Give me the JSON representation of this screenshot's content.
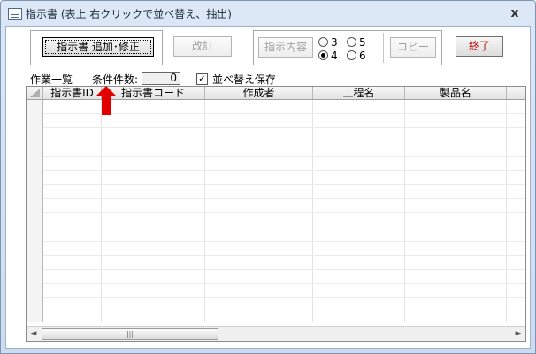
{
  "window": {
    "title": "指示書 (表上 右クリックで並べ替え、抽出)",
    "close_symbol": "x"
  },
  "toolbar": {
    "add_edit_label": "指示書 追加･修正",
    "revise_label": "改訂",
    "instructions_label": "指示内容",
    "copy_label": "コピー",
    "exit_label": "終了"
  },
  "radio_options": [
    {
      "label": "3",
      "checked": false
    },
    {
      "label": "5",
      "checked": false
    },
    {
      "label": "4",
      "checked": true
    },
    {
      "label": "6",
      "checked": false
    }
  ],
  "status": {
    "list_title": "作業一覧",
    "count_label": "条件件数:",
    "count_value": "0",
    "save_sort_label": "並べ替え保存",
    "save_sort_checked": true
  },
  "table": {
    "columns": [
      "指示書ID",
      "指示書コード",
      "作成者",
      "工程名",
      "製品名"
    ]
  },
  "scrollbar": {
    "left_arrow": "◄",
    "right_arrow": "►",
    "thumb_grip": "|||"
  },
  "colors": {
    "accent_red": "#e00000",
    "exit_text": "#c00000",
    "frame": "#cddcf0"
  }
}
